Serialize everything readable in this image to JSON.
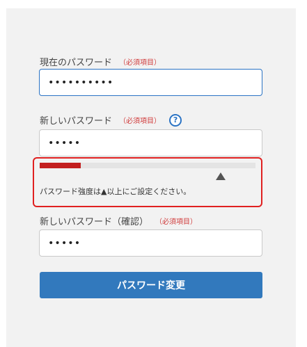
{
  "form": {
    "current_password": {
      "label": "現在のパスワード",
      "required": "（必須項目）",
      "value": "••••••••••"
    },
    "new_password": {
      "label": "新しいパスワード",
      "required": "（必須項目）",
      "help_icon": "?",
      "value": "•••••"
    },
    "strength": {
      "level_fraction": 0.19,
      "bar_color": "#c31f1f",
      "border_color": "#e02020",
      "icon": "triangle-up-icon",
      "message": "パスワード強度は▲以上にご設定ください。"
    },
    "confirm_password": {
      "label": "新しいパスワード（確認）",
      "required": "（必須項目）",
      "value": "•••••"
    },
    "submit_label": "パスワード変更",
    "accent_color": "#3279bd"
  }
}
